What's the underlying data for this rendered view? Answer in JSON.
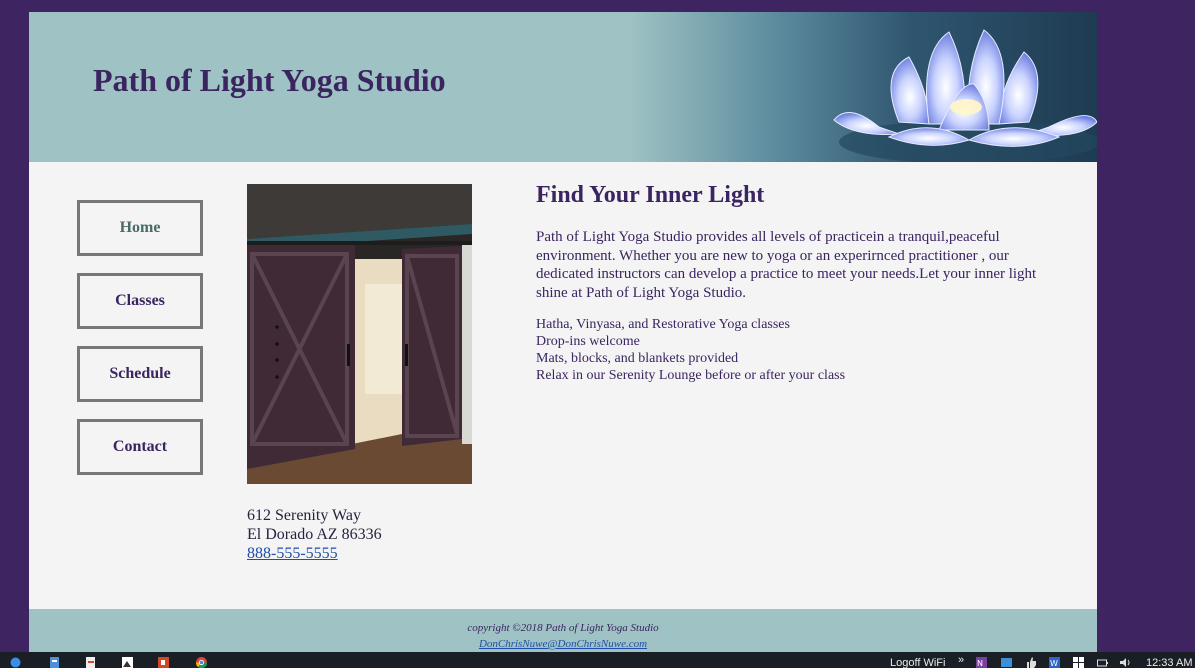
{
  "site": {
    "title": "Path of Light Yoga Studio"
  },
  "nav": {
    "items": [
      {
        "label": "Home",
        "active": true
      },
      {
        "label": "Classes",
        "active": false
      },
      {
        "label": "Schedule",
        "active": false
      },
      {
        "label": "Contact",
        "active": false
      }
    ]
  },
  "main": {
    "heading": "Find Your Inner Light",
    "intro": "Path of Light Yoga Studio provides all levels of practicein a tranquil,peaceful environment. Whether you are new to yoga or an experirnced practitioner , our dedicated instructors can develop a practice to meet your needs.Let your inner light shine at Path of Light Yoga Studio.",
    "features": [
      "Hatha, Vinyasa, and Restorative Yoga classes",
      "Drop-ins welcome",
      "Mats, blocks, and blankets provided",
      "Relax in our Serenity Lounge before or after your class"
    ]
  },
  "contact": {
    "street": "612 Serenity Way",
    "city": "El Dorado AZ 86336",
    "phone": "888-555-5555"
  },
  "footer": {
    "copyright": "copyright ©2018 Path of Light Yoga Studio",
    "email": "DonChrisNuwe@DonChrisNuwe.com"
  },
  "taskbar": {
    "logoff_label": "Logoff WiFi",
    "overflow_chevron": "»",
    "time": "12:33 AM",
    "icons": [
      "windows-start-icon",
      "notepad-icon",
      "document-icon",
      "image-icon",
      "powerpoint-icon",
      "chrome-icon",
      "onenote-icon",
      "network-icon",
      "thumbs-up-icon",
      "word-icon",
      "windows-logo-icon",
      "battery-icon",
      "volume-icon"
    ]
  },
  "colors": {
    "outer_background": "#3f2462",
    "header_teal": "#9fc3c4",
    "page_background": "#f4f4f4",
    "heading_purple": "#3a2560",
    "link_blue": "#1f4fa8"
  }
}
